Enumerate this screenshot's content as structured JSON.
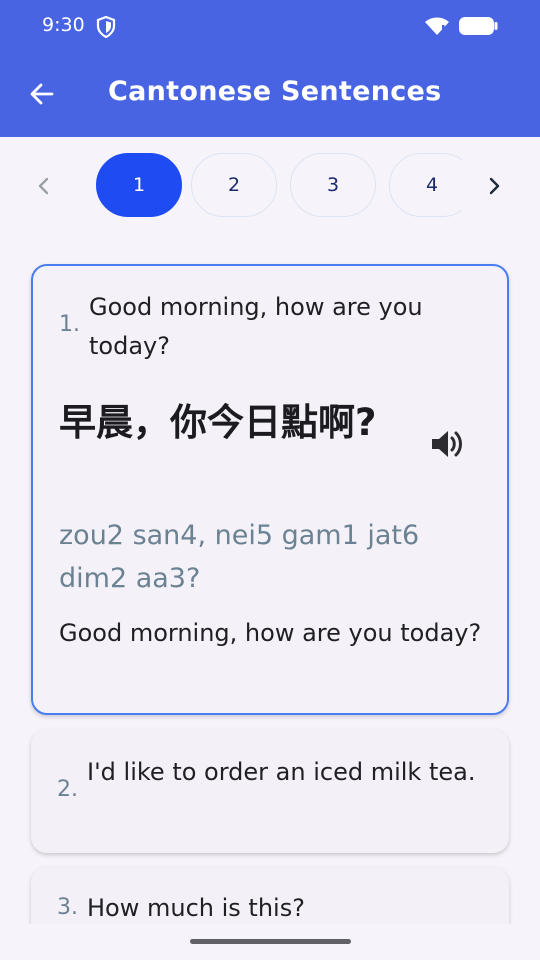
{
  "status_bar": {
    "time": "9:30"
  },
  "app_bar": {
    "title": "Cantonese Sentences"
  },
  "pager": {
    "pages": [
      "1",
      "2",
      "3",
      "4"
    ],
    "active": "1"
  },
  "sentences": [
    {
      "number": "1.",
      "english": "Good morning, how are you today?",
      "chinese": "早晨，你今日點啊?",
      "jyutping": "zou2 san4, nei5 gam1 jat6 dim2 aa3?",
      "translation": "Good morning, how are you today?"
    },
    {
      "number": "2.",
      "english": "I'd like to order an iced milk tea."
    },
    {
      "number": "3.",
      "english": "How much is this?"
    }
  ],
  "colors": {
    "header": "#4864e3",
    "active_pill": "#1e4cf2",
    "accent_border": "#4a7ef0",
    "muted_text": "#6b8293"
  }
}
